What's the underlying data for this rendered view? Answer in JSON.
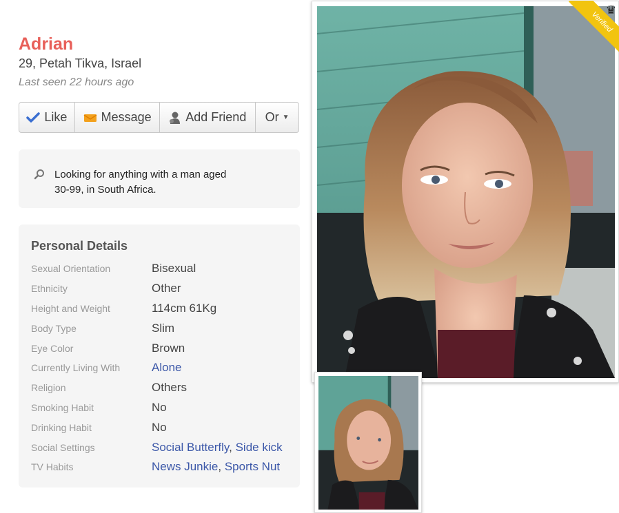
{
  "profile": {
    "name": "Adrian",
    "subtitle": "29, Petah Tikva, Israel",
    "last_seen": "Last seen 22 hours ago"
  },
  "actions": {
    "like": "Like",
    "message": "Message",
    "add_friend": "Add Friend",
    "or": "Or"
  },
  "looking_for": "Looking for anything with a man aged 30-99, in South Africa.",
  "details": {
    "title": "Personal Details",
    "rows": [
      {
        "key": "Sexual Orientation",
        "value": "Bisexual"
      },
      {
        "key": "Ethnicity",
        "value": "Other"
      },
      {
        "key": "Height and Weight",
        "value": "114cm 61Kg"
      },
      {
        "key": "Body Type",
        "value": "Slim"
      },
      {
        "key": "Eye Color",
        "value": "Brown"
      },
      {
        "key": "Currently Living With",
        "value": "Alone"
      },
      {
        "key": "Religion",
        "value": "Others"
      },
      {
        "key": "Smoking Habit",
        "value": "No"
      },
      {
        "key": "Drinking Habit",
        "value": "No"
      },
      {
        "key": "Social Settings",
        "value_a": "Social Butterfly",
        "value_b": "Side kick"
      },
      {
        "key": "TV Habits",
        "value_a": "News Junkie",
        "value_b": "Sports Nut"
      }
    ]
  },
  "photo": {
    "badge": "Verified"
  },
  "colors": {
    "name": "#e8605a",
    "link": "#3b57a8",
    "badge": "#f2c40f"
  },
  "icons": [
    "checkmark-icon",
    "envelope-icon",
    "person-add-icon",
    "caret-down-icon",
    "search-icon",
    "crown-icon"
  ]
}
